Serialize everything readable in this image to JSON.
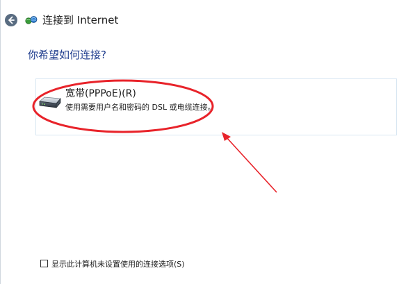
{
  "header": {
    "title": "连接到 Internet",
    "back_icon": "back-arrow-icon",
    "network_icon": "network-globe-icon"
  },
  "main": {
    "question": "你希望如何连接?",
    "options": [
      {
        "title": "宽带(PPPoE)(R)",
        "description": "使用需要用户名和密码的 DSL 或电缆连接。",
        "icon": "modem-icon"
      }
    ]
  },
  "footer": {
    "checkbox_label": "显示此计算机未设置使用的连接选项(S)",
    "checkbox_checked": false
  },
  "colors": {
    "accent_text": "#1c3a8c",
    "annotation_red": "#e8232a",
    "back_button": "#596c81"
  }
}
